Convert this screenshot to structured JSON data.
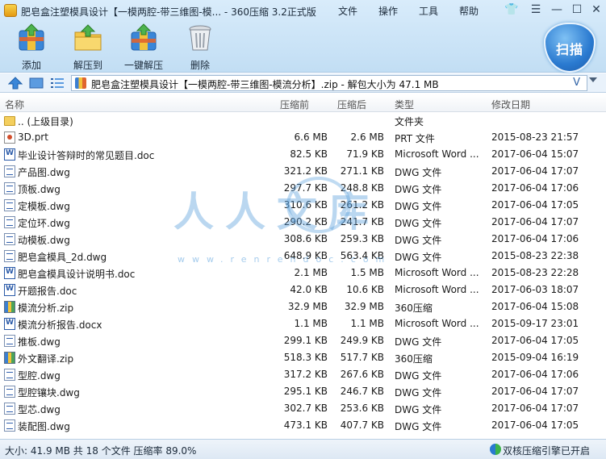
{
  "window": {
    "title": "肥皂盒注塑模具设计【一模两腔-带三维图-模...  - 360压缩 3.2正式版",
    "menu": [
      "文件",
      "操作",
      "工具",
      "帮助"
    ]
  },
  "toolbar": {
    "add": "添加",
    "extract": "解压到",
    "one_click": "一键解压",
    "delete": "删除",
    "scan": "扫描"
  },
  "address": {
    "path": "肥皂盒注塑模具设计【一模两腔-带三维图-模流分析】.zip - 解包大小为 47.1 MB",
    "v": "V"
  },
  "columns": {
    "name": "名称",
    "size": "压缩前",
    "packed": "压缩后",
    "type": "类型",
    "date": "修改日期"
  },
  "files": [
    {
      "name": ".. (上级目录)",
      "size": "",
      "packed": "",
      "type": "文件夹",
      "date": "",
      "icon": "folder"
    },
    {
      "name": "3D.prt",
      "size": "6.6 MB",
      "packed": "2.6 MB",
      "type": "PRT 文件",
      "date": "2015-08-23 21:57",
      "icon": "prt"
    },
    {
      "name": "毕业设计答辩时的常见题目.doc",
      "size": "82.5 KB",
      "packed": "71.9 KB",
      "type": "Microsoft Word ...",
      "date": "2017-06-04 15:07",
      "icon": "word"
    },
    {
      "name": "产品图.dwg",
      "size": "321.2 KB",
      "packed": "271.1 KB",
      "type": "DWG 文件",
      "date": "2017-06-04 17:07",
      "icon": "doc"
    },
    {
      "name": "顶板.dwg",
      "size": "297.7 KB",
      "packed": "248.8 KB",
      "type": "DWG 文件",
      "date": "2017-06-04 17:06",
      "icon": "doc"
    },
    {
      "name": "定模板.dwg",
      "size": "310.6 KB",
      "packed": "261.2 KB",
      "type": "DWG 文件",
      "date": "2017-06-04 17:05",
      "icon": "doc"
    },
    {
      "name": "定位环.dwg",
      "size": "290.2 KB",
      "packed": "241.7 KB",
      "type": "DWG 文件",
      "date": "2017-06-04 17:07",
      "icon": "doc"
    },
    {
      "name": "动模板.dwg",
      "size": "308.6 KB",
      "packed": "259.3 KB",
      "type": "DWG 文件",
      "date": "2017-06-04 17:06",
      "icon": "doc"
    },
    {
      "name": "肥皂盒模具_2d.dwg",
      "size": "648.9 KB",
      "packed": "563.4 KB",
      "type": "DWG 文件",
      "date": "2015-08-23 22:38",
      "icon": "doc"
    },
    {
      "name": "肥皂盒模具设计说明书.doc",
      "size": "2.1 MB",
      "packed": "1.5 MB",
      "type": "Microsoft Word ...",
      "date": "2015-08-23 22:28",
      "icon": "word"
    },
    {
      "name": "开题报告.doc",
      "size": "42.0 KB",
      "packed": "10.6 KB",
      "type": "Microsoft Word ...",
      "date": "2017-06-03 18:07",
      "icon": "word"
    },
    {
      "name": "模流分析.zip",
      "size": "32.9 MB",
      "packed": "32.9 MB",
      "type": "360压缩",
      "date": "2017-06-04 15:08",
      "icon": "zip"
    },
    {
      "name": "模流分析报告.docx",
      "size": "1.1 MB",
      "packed": "1.1 MB",
      "type": "Microsoft Word ...",
      "date": "2015-09-17 23:01",
      "icon": "word"
    },
    {
      "name": "推板.dwg",
      "size": "299.1 KB",
      "packed": "249.9 KB",
      "type": "DWG 文件",
      "date": "2017-06-04 17:05",
      "icon": "doc"
    },
    {
      "name": "外文翻译.zip",
      "size": "518.3 KB",
      "packed": "517.7 KB",
      "type": "360压缩",
      "date": "2015-09-04 16:19",
      "icon": "zip"
    },
    {
      "name": "型腔.dwg",
      "size": "317.2 KB",
      "packed": "267.6 KB",
      "type": "DWG 文件",
      "date": "2017-06-04 17:06",
      "icon": "doc"
    },
    {
      "name": "型腔镶块.dwg",
      "size": "295.1 KB",
      "packed": "246.7 KB",
      "type": "DWG 文件",
      "date": "2017-06-04 17:07",
      "icon": "doc"
    },
    {
      "name": "型芯.dwg",
      "size": "302.7 KB",
      "packed": "253.6 KB",
      "type": "DWG 文件",
      "date": "2017-06-04 17:07",
      "icon": "doc"
    },
    {
      "name": "装配图.dwg",
      "size": "473.1 KB",
      "packed": "407.7 KB",
      "type": "DWG 文件",
      "date": "2017-06-04 17:05",
      "icon": "doc"
    }
  ],
  "watermark": {
    "text": "人人文库",
    "url": "www.renrendoc.com"
  },
  "status": {
    "summary": "大小: 41.9 MB 共 18 个文件 压缩率 89.0%",
    "engine": "双核压缩引擎已开启"
  }
}
